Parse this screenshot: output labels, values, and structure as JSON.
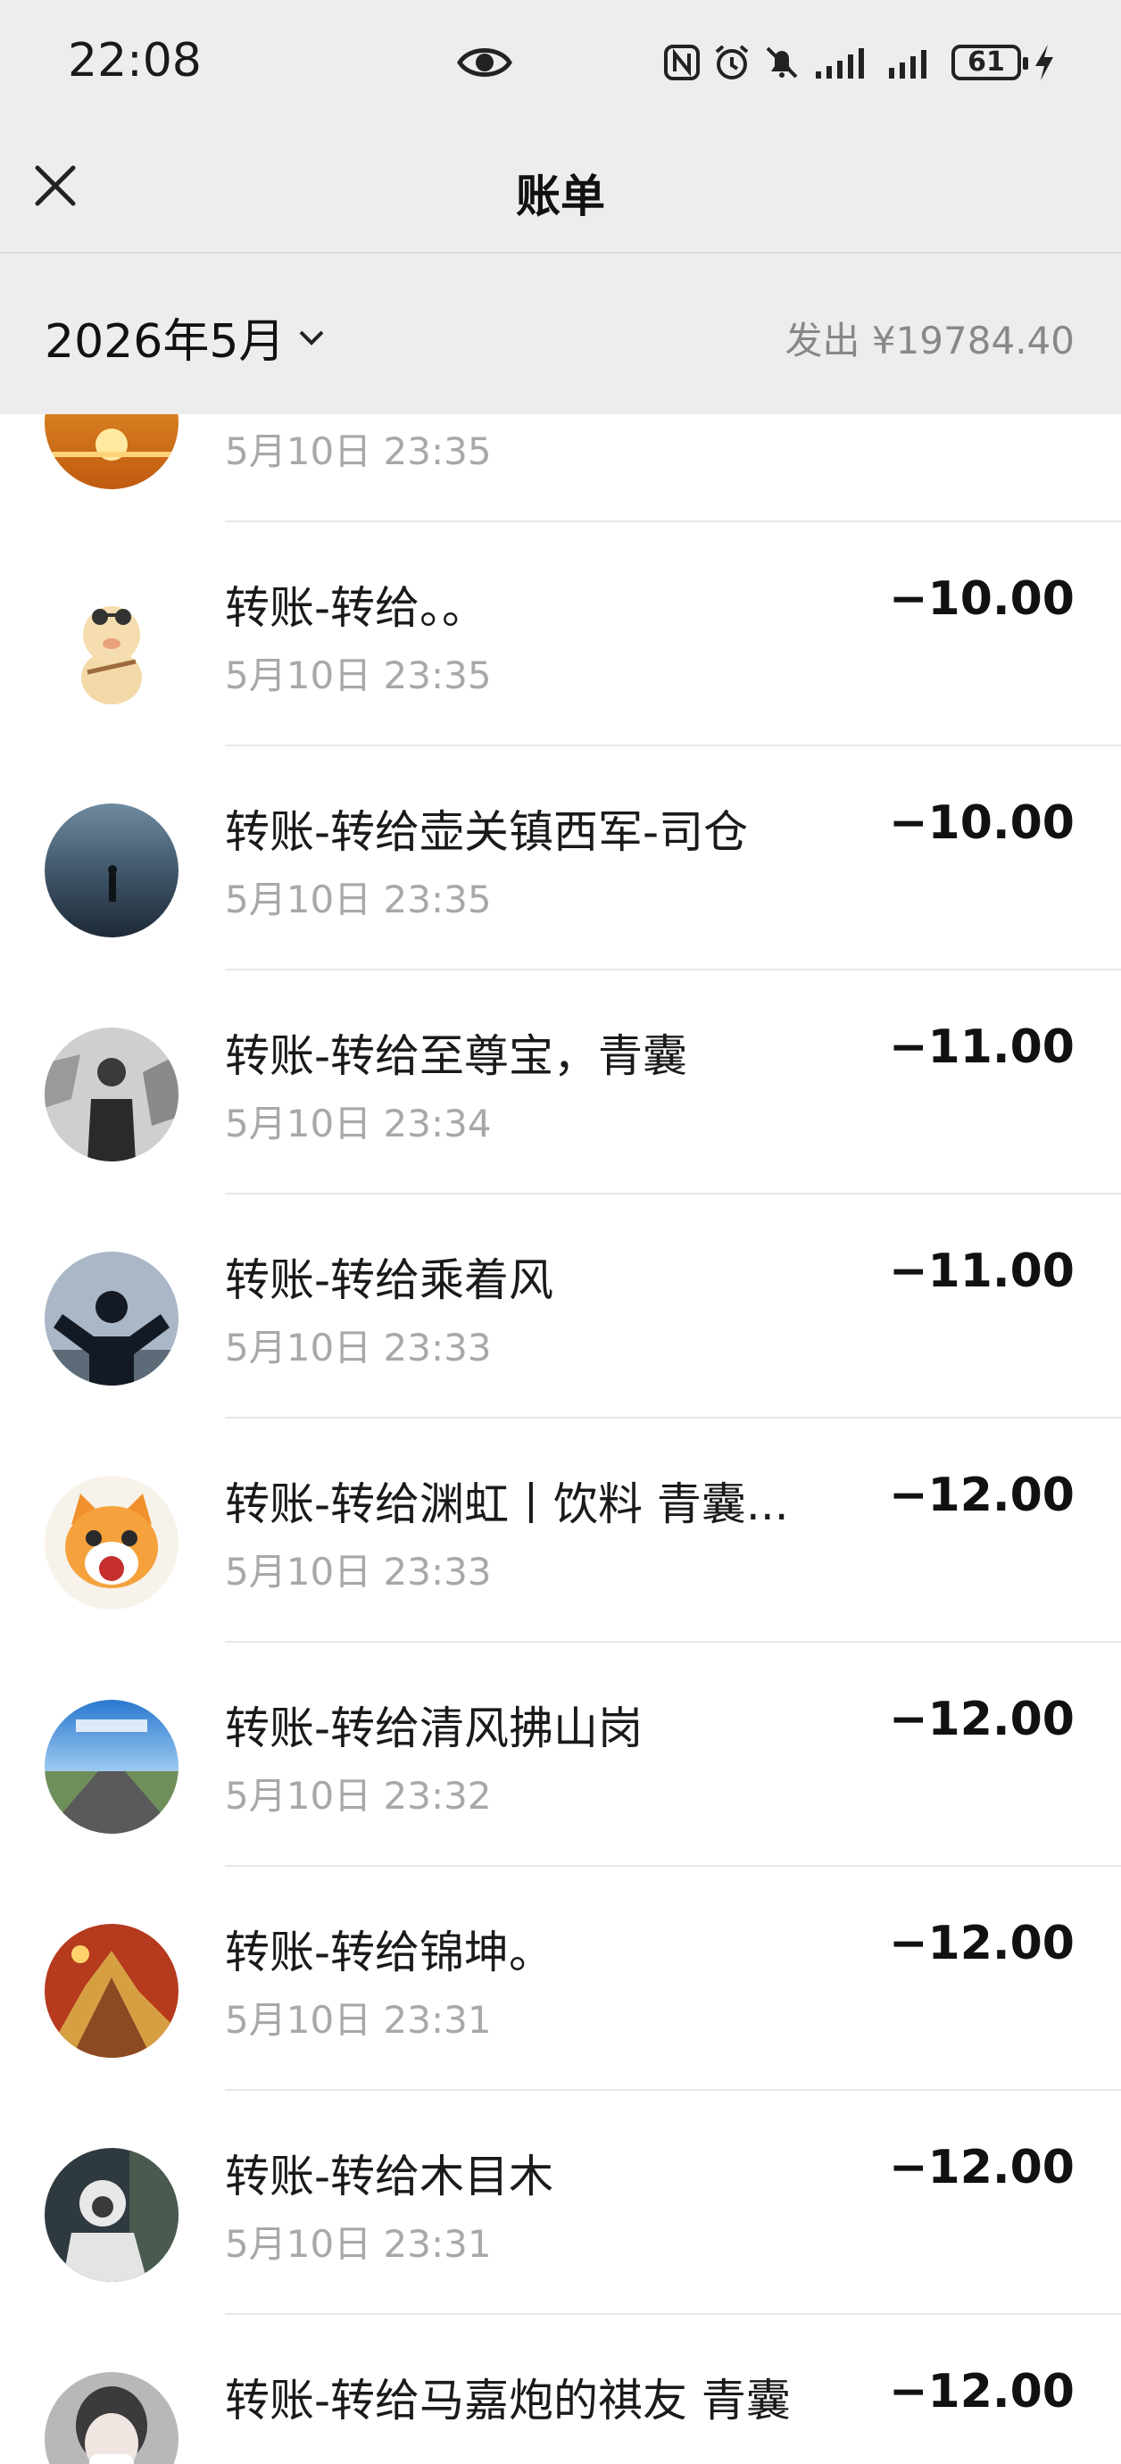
{
  "status_bar": {
    "time": "22:08",
    "battery": "61",
    "icons": [
      "eye-icon",
      "nfc-icon",
      "alarm-icon",
      "mute-icon",
      "signal-icon",
      "signal-icon",
      "battery-icon",
      "charging-icon"
    ]
  },
  "header": {
    "title": "账单",
    "close_icon": "close-icon"
  },
  "month_bar": {
    "month": "2026年5月",
    "spent": "发出 ¥19784.40"
  },
  "transactions": [
    {
      "title": "",
      "time": "5月10日 23:35",
      "amount": "",
      "avatar": "sunset"
    },
    {
      "title": "转账-转给。。",
      "time": "5月10日 23:35",
      "amount": "−10.00",
      "avatar": "monkey-doll"
    },
    {
      "title": "转账-转给壶关镇西军-司仓",
      "time": "5月10日 23:35",
      "amount": "−10.00",
      "avatar": "sea-figure"
    },
    {
      "title": "转账-转给至尊宝，青囊",
      "time": "5月10日 23:34",
      "amount": "−11.00",
      "avatar": "bw-man"
    },
    {
      "title": "转账-转给乘着风",
      "time": "5月10日 23:33",
      "amount": "−11.00",
      "avatar": "arms-up"
    },
    {
      "title": "转账-转给渊虹丨饮料 青囊...",
      "time": "5月10日 23:33",
      "amount": "−12.00",
      "avatar": "cartoon-cat"
    },
    {
      "title": "转账-转给清风拂山岗",
      "time": "5月10日 23:32",
      "amount": "−12.00",
      "avatar": "road"
    },
    {
      "title": "转账-转给锦坤。",
      "time": "5月10日 23:31",
      "amount": "−12.00",
      "avatar": "golden-mountain"
    },
    {
      "title": "转账-转给木目木",
      "time": "5月10日 23:31",
      "amount": "−12.00",
      "avatar": "hooded-figure"
    },
    {
      "title": "转账-转给马嘉炮的祺友 青囊",
      "time": "",
      "amount": "−12.00",
      "avatar": "mask-girl"
    }
  ]
}
